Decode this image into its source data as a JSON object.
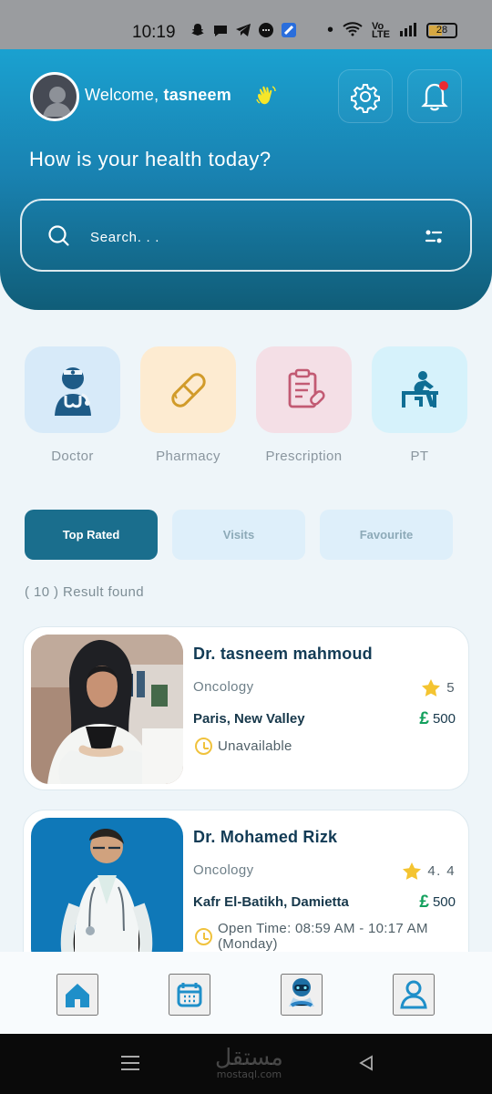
{
  "status": {
    "time": "10:19",
    "battery": "28"
  },
  "header": {
    "welcome_prefix": "Welcome,",
    "user_name": "tasneem",
    "question": "How is your health today?"
  },
  "search": {
    "placeholder": "Search. . ."
  },
  "categories": [
    {
      "label": "Doctor",
      "icon": "doctor-icon"
    },
    {
      "label": "Pharmacy",
      "icon": "pill-icon"
    },
    {
      "label": "Prescription",
      "icon": "prescription-icon"
    },
    {
      "label": "PT",
      "icon": "physical-therapy-icon"
    }
  ],
  "tabs": [
    {
      "label": "Top Rated",
      "selected": true
    },
    {
      "label": "Visits",
      "selected": false
    },
    {
      "label": "Favourite",
      "selected": false
    }
  ],
  "results": "( 10 ) Result found",
  "doctors": [
    {
      "name": "Dr.  tasneem mahmoud",
      "specialty": "Oncology",
      "rating": "5",
      "location": "Paris, New Valley",
      "price": "500",
      "availability": "Unavailable"
    },
    {
      "name": "Dr.  Mohamed Rizk",
      "specialty": "Oncology",
      "rating": "4. 4",
      "location": "Kafr El-Batikh, Damietta",
      "price": "500",
      "availability_line1": "Open Time: 08:59 AM - 10:17 AM",
      "availability_line2": "(Monday)"
    }
  ],
  "bottom_nav": [
    {
      "name": "home-icon"
    },
    {
      "name": "calendar-icon"
    },
    {
      "name": "ai-assistant-icon"
    },
    {
      "name": "profile-icon"
    }
  ],
  "watermark": {
    "arabic": "مستقل",
    "english": "mostaql.com"
  },
  "colors": {
    "primary": "#1a6e8d",
    "hero_top": "#1aa1d0",
    "hero_bottom": "#105d78",
    "star": "#f4c431",
    "price": "#13a05d"
  }
}
